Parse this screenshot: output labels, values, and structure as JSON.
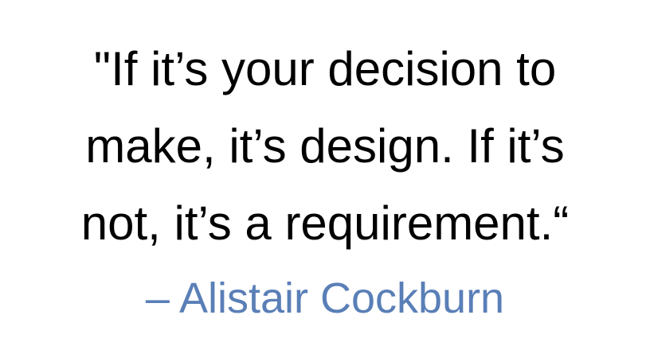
{
  "quote": {
    "lines": [
      "\"If it’s your decision to",
      "make, it’s design. If it’s",
      "not, it’s a requirement.“"
    ]
  },
  "attribution": {
    "text": "– Alistair Cockburn",
    "color": "#5a7fb7"
  }
}
